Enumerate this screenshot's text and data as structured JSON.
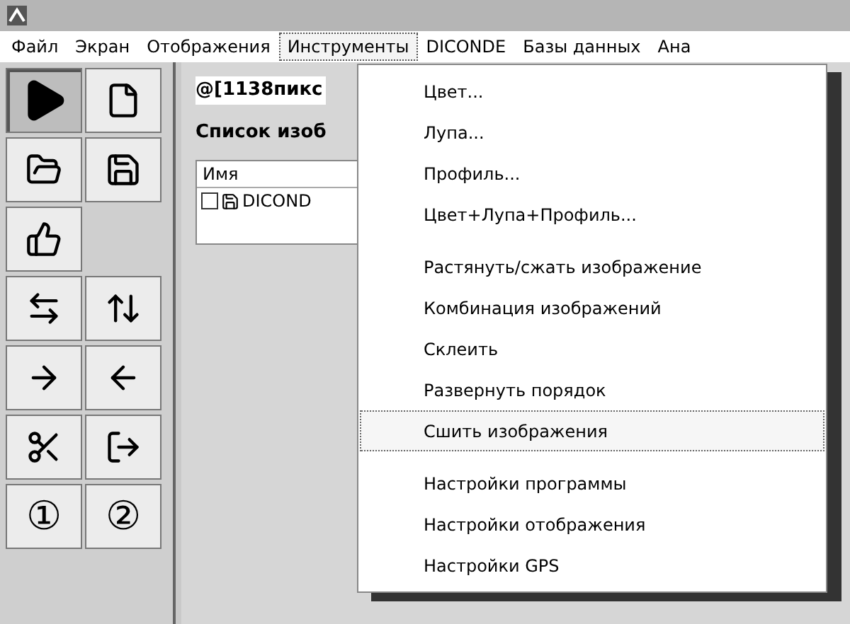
{
  "menu_bar": [
    {
      "label": "Файл",
      "selected": false
    },
    {
      "label": "Экран",
      "selected": false
    },
    {
      "label": "Отображения",
      "selected": false
    },
    {
      "label": "Инструменты",
      "selected": true
    },
    {
      "label": "DICONDE",
      "selected": false
    },
    {
      "label": "Базы данных",
      "selected": false
    },
    {
      "label": "Ана",
      "selected": false
    }
  ],
  "toolbar": [
    {
      "kind": "play",
      "selected": true
    },
    {
      "kind": "new",
      "selected": false
    },
    {
      "kind": "open",
      "selected": false
    },
    {
      "kind": "save",
      "selected": false
    },
    {
      "kind": "thumb",
      "selected": false
    },
    {
      "kind": "hflip",
      "selected": false
    },
    {
      "kind": "vflip",
      "selected": false
    },
    {
      "kind": "moveright",
      "selected": false
    },
    {
      "kind": "moveleft",
      "selected": false
    },
    {
      "kind": "cut",
      "selected": false
    },
    {
      "kind": "export",
      "selected": false
    },
    {
      "kind": "text",
      "label": "①",
      "selected": false
    },
    {
      "kind": "text",
      "label": "②",
      "selected": false
    }
  ],
  "panel": {
    "title": "@[1138пикс",
    "list_title": "Список изоб",
    "list": {
      "column": "Имя",
      "rows": [
        {
          "name": "DICOND",
          "checked": false
        }
      ]
    }
  },
  "dropdown": [
    [
      {
        "label": "Цвет...",
        "selected": false
      },
      {
        "label": "Лупа...",
        "selected": false
      },
      {
        "label": "Профиль...",
        "selected": false
      },
      {
        "label": "Цвет+Лупа+Профиль...",
        "selected": false
      }
    ],
    [
      {
        "label": "Растянуть/сжать изображение",
        "selected": false
      },
      {
        "label": "Комбинация изображений",
        "selected": false
      },
      {
        "label": "Склеить",
        "selected": false
      },
      {
        "label": "Развернуть порядок",
        "selected": false
      },
      {
        "label": "Сшить изображения",
        "selected": true
      }
    ],
    [
      {
        "label": "Настройки программы",
        "selected": false
      },
      {
        "label": "Настройки отображения",
        "selected": false
      },
      {
        "label": "Настройки GPS",
        "selected": false
      }
    ]
  ]
}
